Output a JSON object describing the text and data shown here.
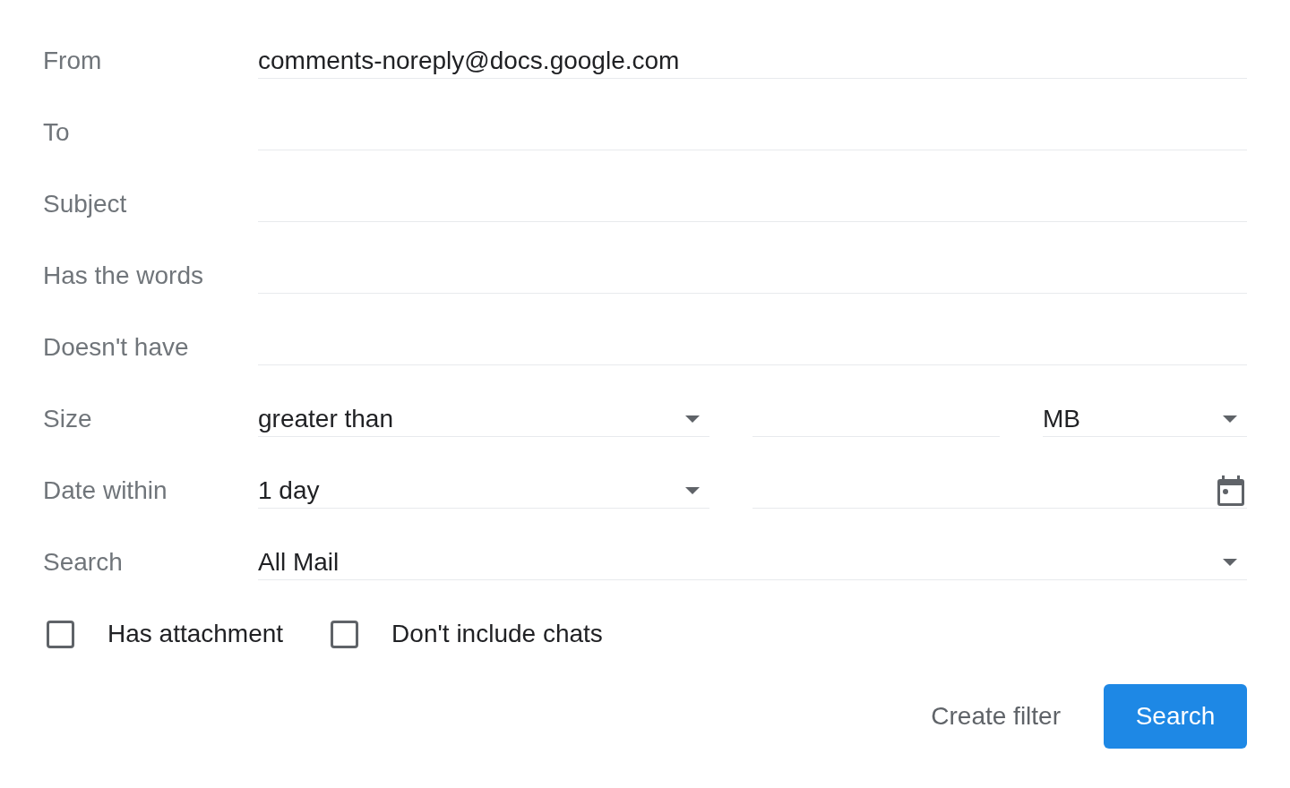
{
  "rows": [
    {
      "kind": "text",
      "label": "From",
      "value": "comments-noreply@docs.google.com"
    },
    {
      "kind": "text",
      "label": "To"
    },
    {
      "kind": "text",
      "label": "Subject"
    },
    {
      "kind": "text",
      "label": "Has the words"
    },
    {
      "kind": "text",
      "label": "Doesn't have"
    },
    {
      "kind": "size",
      "label": "Size",
      "comparison": "greater than",
      "unit": "MB"
    },
    {
      "kind": "date",
      "label": "Date within",
      "range": "1 day"
    },
    {
      "kind": "select",
      "label": "Search",
      "value": "All Mail"
    }
  ],
  "options": [
    {
      "label": "Has attachment",
      "checked": false
    },
    {
      "label": "Don't include chats",
      "checked": false
    }
  ],
  "actions": [
    {
      "kind": "text",
      "label": "Create filter"
    },
    {
      "kind": "primary",
      "label": "Search"
    }
  ]
}
